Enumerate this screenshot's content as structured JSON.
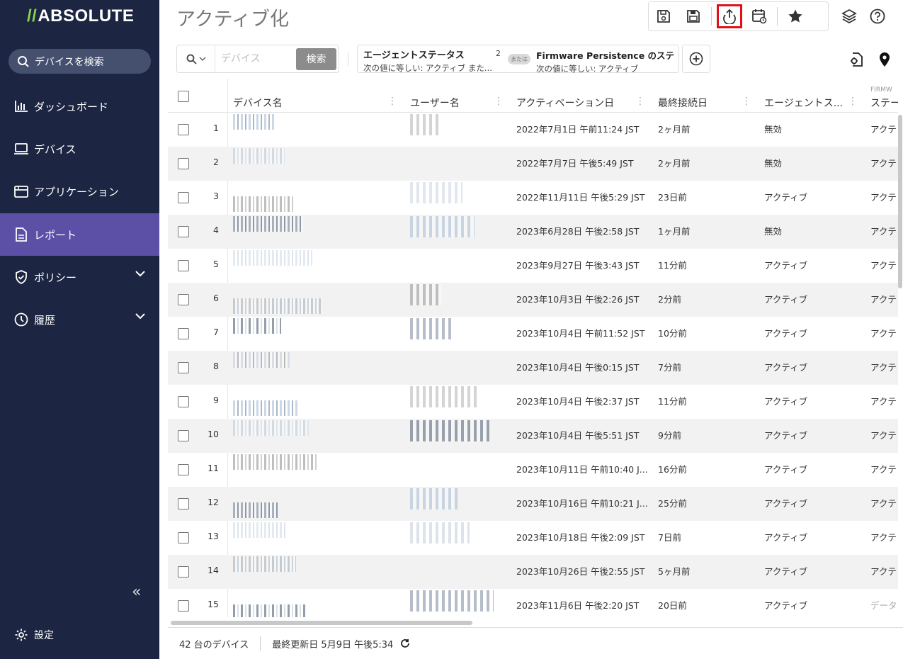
{
  "app": {
    "logo": "ABSOLUTE",
    "page_title": "アクティブ化"
  },
  "sidebar": {
    "search_label": "デバイスを検索",
    "items": [
      {
        "label": "ダッシュボード",
        "icon": "bar-chart-icon"
      },
      {
        "label": "デバイス",
        "icon": "laptop-icon"
      },
      {
        "label": "アプリケーション",
        "icon": "window-icon"
      },
      {
        "label": "レポート",
        "icon": "report-icon",
        "active": true
      },
      {
        "label": "ポリシー",
        "icon": "shield-icon",
        "expandable": true
      },
      {
        "label": "履歴",
        "icon": "clock-icon",
        "expandable": true
      }
    ],
    "collapse_label": "«",
    "settings_label": "設定"
  },
  "toolbar": {
    "buttons": [
      "save-icon",
      "save-as-icon",
      "export-icon",
      "schedule-icon",
      "favorite-star-icon"
    ],
    "highlighted": "export-icon"
  },
  "search": {
    "placeholder": "デバイス",
    "button_label": "検索"
  },
  "filter": {
    "title": "エージェントステータス",
    "count": "2",
    "subtitle": "次の値に等しい: アクティブ また...",
    "or_label": "または",
    "title2": "Firmware Persistence のステ...",
    "subtitle2": "次の値に等しい: アクティブ"
  },
  "table": {
    "columns": [
      "デバイス名",
      "ユーザー名",
      "アクティベーション日",
      "最終接続日",
      "エージェントス...",
      "ステー"
    ],
    "last_column_overline": "FIRMW",
    "rows": [
      {
        "num": "1",
        "activation": "2022年7月1日 午前11:24 JST",
        "last_connected": "2ヶ月前",
        "agent_status": "無効",
        "status": "アクテ"
      },
      {
        "num": "2",
        "activation": "2022年7月7日 午後5:49 JST",
        "last_connected": "2ヶ月前",
        "agent_status": "無効",
        "status": "アクテ"
      },
      {
        "num": "3",
        "activation": "2022年11月11日 午後5:29 JST",
        "last_connected": "23日前",
        "agent_status": "アクティブ",
        "status": "アクテ"
      },
      {
        "num": "4",
        "activation": "2023年6月28日 午後2:58 JST",
        "last_connected": "1ヶ月前",
        "agent_status": "無効",
        "status": "アクテ"
      },
      {
        "num": "5",
        "activation": "2023年9月27日 午後3:43 JST",
        "last_connected": "11分前",
        "agent_status": "アクティブ",
        "status": "アクテ"
      },
      {
        "num": "6",
        "activation": "2023年10月3日 午後2:26 JST",
        "last_connected": "2分前",
        "agent_status": "アクティブ",
        "status": "アクテ"
      },
      {
        "num": "7",
        "activation": "2023年10月4日 午前11:52 JST",
        "last_connected": "10分前",
        "agent_status": "アクティブ",
        "status": "アクテ"
      },
      {
        "num": "8",
        "activation": "2023年10月4日 午後0:15 JST",
        "last_connected": "7分前",
        "agent_status": "アクティブ",
        "status": "アクテ"
      },
      {
        "num": "9",
        "activation": "2023年10月4日 午後2:37 JST",
        "last_connected": "11分前",
        "agent_status": "アクティブ",
        "status": "アクテ"
      },
      {
        "num": "10",
        "activation": "2023年10月4日 午後5:51 JST",
        "last_connected": "9分前",
        "agent_status": "アクティブ",
        "status": "アクテ"
      },
      {
        "num": "11",
        "activation": "2023年10月11日 午前10:40 J...",
        "last_connected": "16分前",
        "agent_status": "アクティブ",
        "status": "アクテ"
      },
      {
        "num": "12",
        "activation": "2023年10月16日 午前10:21 J...",
        "last_connected": "25分前",
        "agent_status": "アクティブ",
        "status": "アクテ"
      },
      {
        "num": "13",
        "activation": "2023年10月18日 午後2:09 JST",
        "last_connected": "7日前",
        "agent_status": "アクティブ",
        "status": "アクテ"
      },
      {
        "num": "14",
        "activation": "2023年10月26日 午後2:55 JST",
        "last_connected": "5ヶ月前",
        "agent_status": "アクティブ",
        "status": "アクテ"
      },
      {
        "num": "15",
        "activation": "2023年11月6日 午後2:20 JST",
        "last_connected": "20日前",
        "agent_status": "アクティブ",
        "status": "データ"
      }
    ]
  },
  "footer": {
    "device_count": "42 台のデバイス",
    "last_updated": "最終更新日 5月9日 午後5:34"
  },
  "colors": {
    "sidebar_bg": "#1c2541",
    "active_nav": "#5c4fa6",
    "logo_accent": "#8fd14f",
    "highlight": "#e0101a"
  }
}
